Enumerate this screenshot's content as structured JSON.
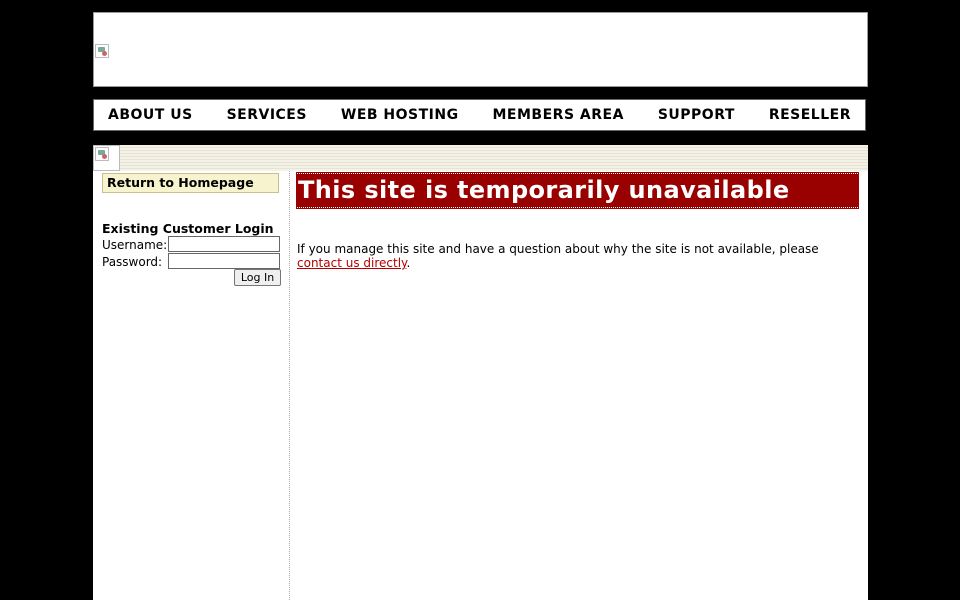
{
  "nav": {
    "items": [
      "ABOUT US",
      "SERVICES",
      "WEB HOSTING",
      "MEMBERS AREA",
      "SUPPORT",
      "RESELLER"
    ]
  },
  "sidebar": {
    "home_link": "Return to Homepage",
    "login": {
      "title": "Existing Customer Login",
      "username_label": "Username:",
      "username_value": "",
      "password_label": "Password:",
      "password_value": "",
      "button_label": "Log In"
    }
  },
  "main": {
    "banner": "This site is temporarily unavailable",
    "message_before": "If you manage this site and have a question about why the site is not available, please ",
    "contact_link": "contact us directly",
    "message_after": "."
  },
  "colors": {
    "page_background": "#000000",
    "banner_background": "#990000",
    "link": "#b30000",
    "home_link_background": "#f7f3cf"
  },
  "icons": {
    "header_logo": "broken-image-icon",
    "stripe_image": "broken-image-icon"
  }
}
